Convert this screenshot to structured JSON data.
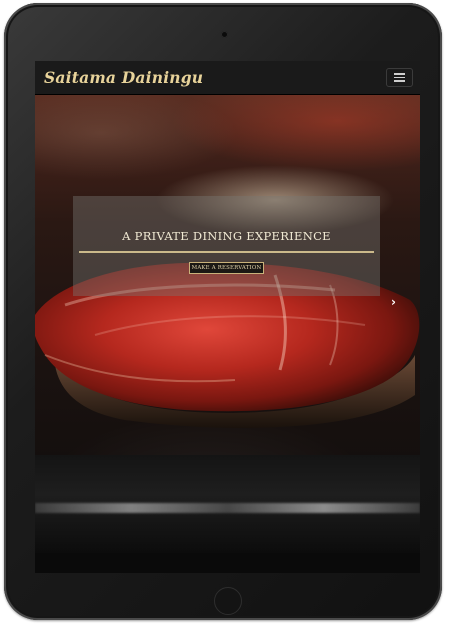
{
  "navbar": {
    "brand": "Saitama Dainingu",
    "menu_icon": "hamburger-menu-icon"
  },
  "hero": {
    "caption_title": "A PRIVATE DINING EXPERIENCE",
    "button_label": "MAKE A RESERVATION",
    "next_icon": "chevron-right-icon",
    "next_glyph": "›"
  },
  "colors": {
    "brand": "#e8d39a",
    "accent_rule": "#cbb98a",
    "navbar_bg": "#1a1a1a"
  }
}
